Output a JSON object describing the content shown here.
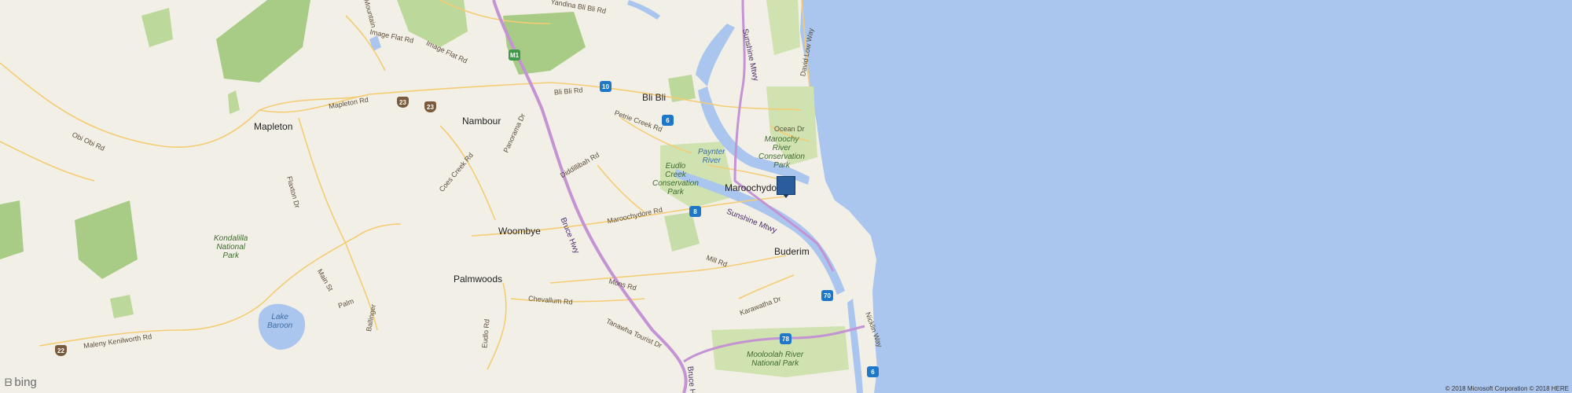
{
  "map": {
    "colors": {
      "water": "#aac6ef",
      "land": "#f2efe6",
      "park": "#cfe2b0",
      "forest": "#a8cc86",
      "motorway": "#c493d4",
      "road": "#f4cc74"
    },
    "towns": [
      "Bli Bli",
      "Nambour",
      "Mapleton",
      "Maroochydore",
      "Woombye",
      "Buderim",
      "Palmwoods"
    ],
    "roads": [
      "Bli Bli Rd",
      "Image Flat Rd",
      "Image Flat Rd",
      "Mapleton Rd",
      "Obi Obi Rd",
      "Panorama Dr",
      "Petrie Creek Rd",
      "Diddillibah Rd",
      "Coes Creek Rd",
      "Flaxton Dr",
      "Maroochydore Rd",
      "Mons Rd",
      "Mill Rd",
      "Chevallum Rd",
      "Main St",
      "Palm",
      "Ballinger",
      "Maleny Kenilworth Rd",
      "Eudlo Rd",
      "Tanawha Tourist Dr",
      "Karawatha Dr",
      "Ocean Dr",
      "Nicklin Way",
      "David Low Way",
      "Kiels Mountain",
      "Yandina Bli Bli Rd"
    ],
    "highways": [
      "Bruce Hwy",
      "Sunshine Mtwy",
      "Sunshine Mtwy",
      "Bruce Hwy"
    ],
    "water_labels": [
      "Paynter\nRiver",
      "Lake\nBaroon"
    ],
    "parks": [
      "Maroochy\nRiver\nConservation\nPark",
      "Eudlo\nCreek\nConservation\nPark",
      "Kondalilla\nNational\nPark",
      "Mooloolah River\nNational Park"
    ],
    "shields": [
      "10",
      "6",
      "8",
      "70",
      "78",
      "6",
      "23",
      "23",
      "22",
      "M1"
    ],
    "pin_icon": "location-marker-icon"
  },
  "footer": {
    "brand": "bing",
    "brand_icon": "bing-logo-icon",
    "copyright": "© 2018 Microsoft Corporation © 2018 HERE"
  }
}
